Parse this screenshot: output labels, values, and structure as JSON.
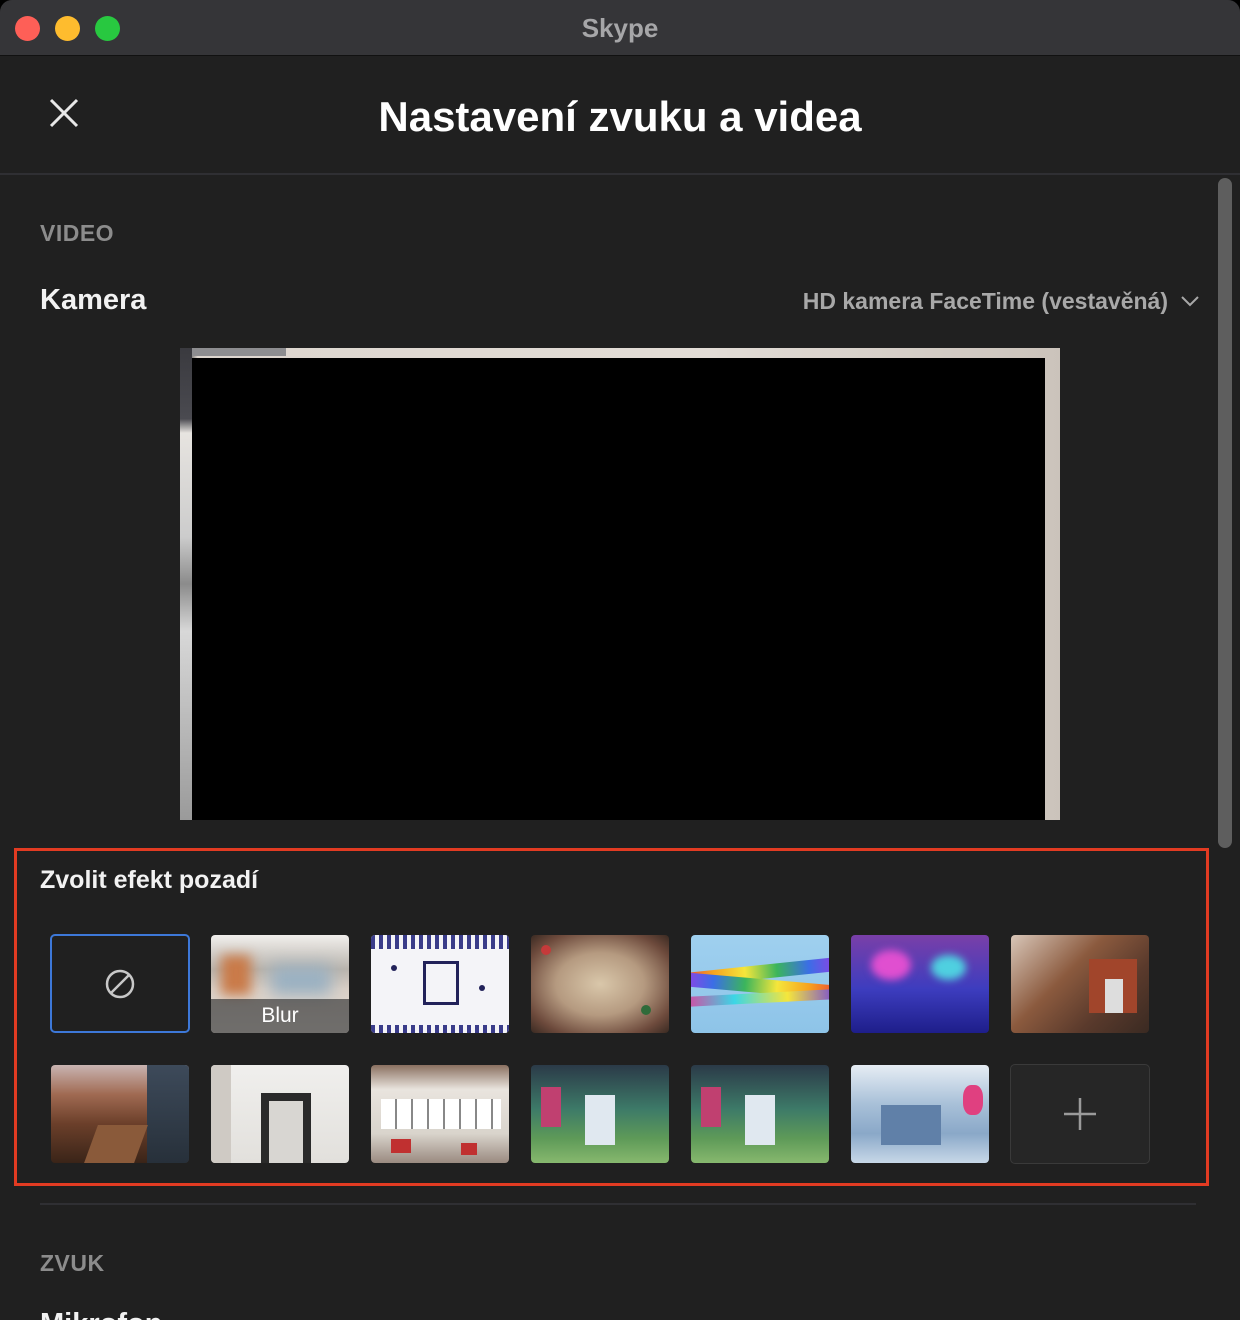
{
  "window": {
    "app_title": "Skype"
  },
  "dialog": {
    "title": "Nastavení zvuku a videa"
  },
  "video": {
    "section_label": "VIDEO",
    "camera_label": "Kamera",
    "camera_value": "HD kamera FaceTime (vestavěná)"
  },
  "effects": {
    "title": "Zvolit efekt pozadí",
    "blur_label": "Blur",
    "tiles": [
      "none",
      "blur",
      "winter-pattern",
      "holiday-frame",
      "colorful-ribbons",
      "purple-fantasy",
      "brick-courtyard",
      "autumn-street",
      "bright-doorway",
      "modern-office",
      "green-lobby",
      "green-lobby-2",
      "blue-lounge",
      "add"
    ]
  },
  "audio": {
    "section_label": "ZVUK",
    "microphone_label": "Mikrofon"
  },
  "colors": {
    "background": "#202020",
    "titlebar": "#353538",
    "selection_border": "#3d78d8",
    "highlight_border": "#e23b22"
  }
}
